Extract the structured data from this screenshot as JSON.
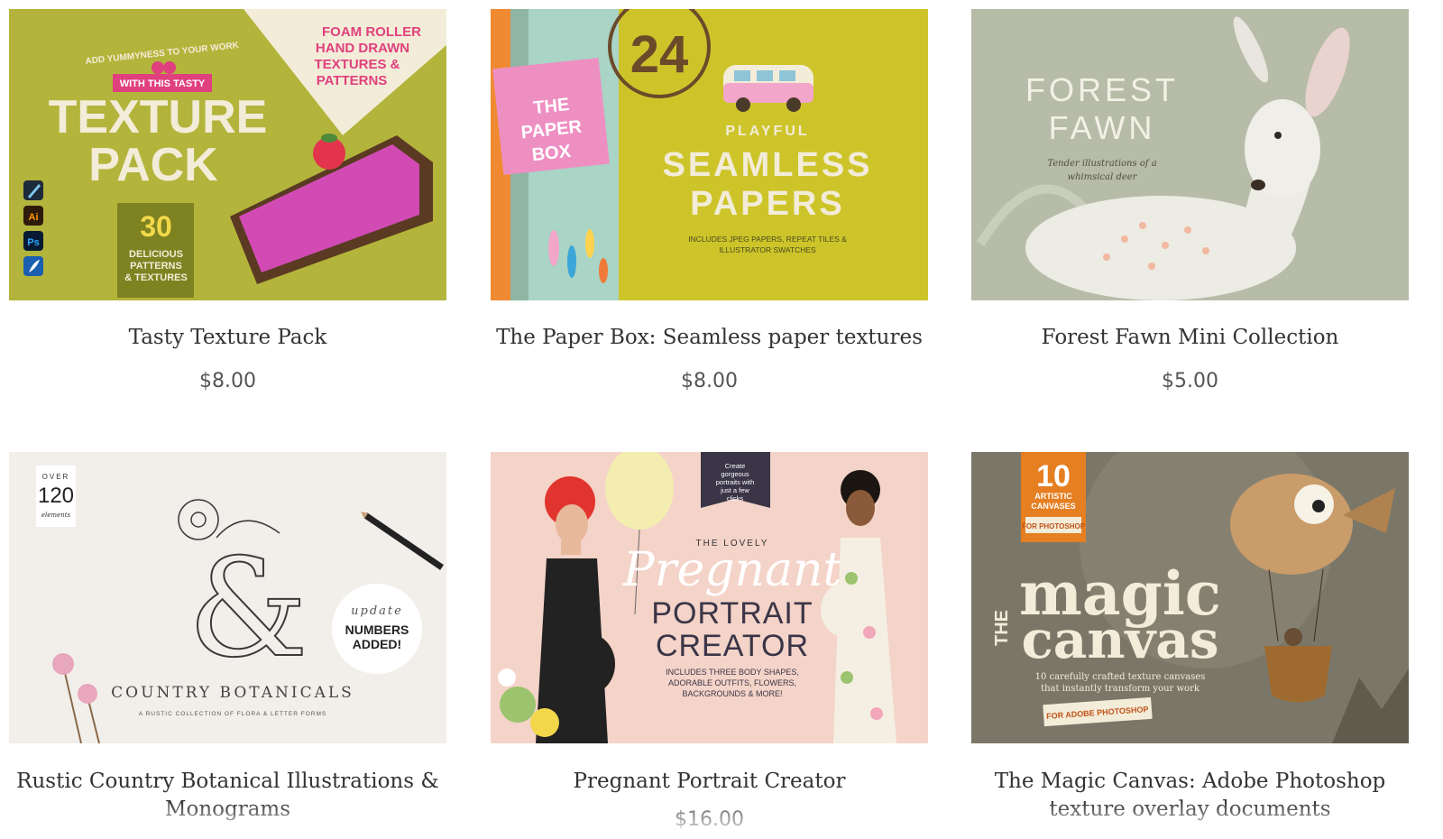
{
  "products": [
    {
      "title": "Tasty Texture Pack",
      "price": "$8.00",
      "art": {
        "top_left": "ADD YUMMYNESS TO YOUR WORK",
        "ribbon": "WITH THIS TASTY",
        "headline_1": "TEXTURE",
        "headline_2": "PACK",
        "corner_1": "FOAM ROLLER",
        "corner_2": "HAND DRAWN",
        "corner_3": "TEXTURES &",
        "corner_4": "PATTERNS",
        "count": "30",
        "count_1": "DELICIOUS",
        "count_2": "PATTERNS",
        "count_3": "& TEXTURES",
        "app_icons": [
          "pen-nib-icon",
          "Ai",
          "Ps",
          "feather-icon"
        ]
      }
    },
    {
      "title": "The Paper Box: Seamless paper textures",
      "price": "$8.00",
      "art": {
        "count": "24",
        "box_1": "THE",
        "box_2": "PAPER",
        "box_3": "BOX",
        "sub": "PLAYFUL",
        "headline_1": "SEAMLESS",
        "headline_2": "PAPERS",
        "small_1": "INCLUDES JPEG PAPERS, REPEAT TILES &",
        "small_2": "ILLUSTRATOR SWATCHES"
      }
    },
    {
      "title": "Forest Fawn Mini Collection",
      "price": "$5.00",
      "art": {
        "headline_1": "FOREST",
        "headline_2": "FAWN",
        "tagline_1": "Tender illustrations of a",
        "tagline_2": "whimsical deer"
      }
    },
    {
      "title": "Rustic Country Botanical Illustrations & Monograms",
      "price": "",
      "art": {
        "over": "OVER",
        "count": "120",
        "elements": "elements",
        "update": "update",
        "badge_1": "NUMBERS",
        "badge_2": "ADDED!",
        "headline": "COUNTRY BOTANICALS",
        "small": "A RUSTIC COLLECTION OF FLORA & LETTER FORMS"
      }
    },
    {
      "title": "Pregnant Portrait Creator",
      "price": "$16.00",
      "art": {
        "tag_1": "Create",
        "tag_2": "gorgeous",
        "tag_3": "portraits with",
        "tag_4": "just a few",
        "tag_5": "clicks",
        "sub": "THE LOVELY",
        "script": "Pregnant",
        "headline_1": "PORTRAIT",
        "headline_2": "CREATOR",
        "small_1": "INCLUDES THREE BODY SHAPES,",
        "small_2": "ADORABLE OUTFITS, FLOWERS,",
        "small_3": "BACKGROUNDS & MORE!"
      }
    },
    {
      "title": "The Magic Canvas: Adobe Photoshop texture overlay documents",
      "price": "",
      "art": {
        "count": "10",
        "count_1": "ARTISTIC",
        "count_2": "CANVASES",
        "count_3": "FOR PHOTOSHOP",
        "the": "THE",
        "headline_1": "magic",
        "headline_2": "canvas",
        "small_1": "10 carefully crafted texture canvases",
        "small_2": "that instantly transform your work",
        "stamp": "FOR ADOBE PHOTOSHOP"
      }
    }
  ],
  "colors": {
    "card_title": "#333333",
    "card_price": "#555555"
  }
}
